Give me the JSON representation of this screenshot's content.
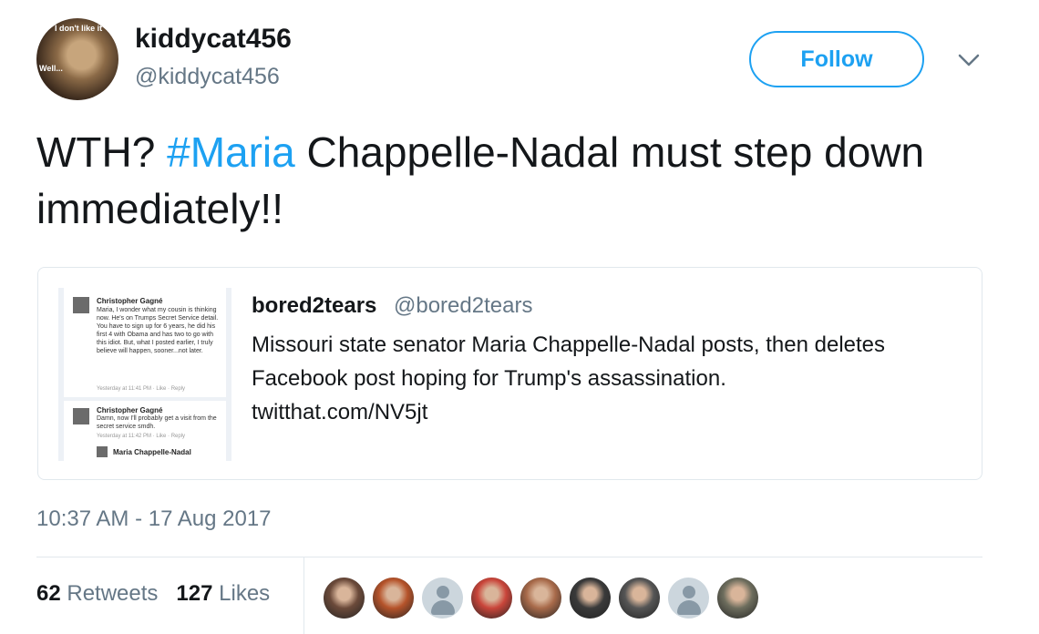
{
  "author": {
    "display_name": "kiddycat456",
    "handle": "@kiddycat456",
    "avatar_text_top": "I don't like it",
    "avatar_text_left": "Well..."
  },
  "follow_label": "Follow",
  "tweet": {
    "text_before": "WTH? ",
    "hashtag": "#Maria",
    "text_after": " Chappelle-Nadal must step down immediately!!"
  },
  "quoted": {
    "name": "bored2tears",
    "handle": "@bored2tears",
    "text": "Missouri state senator Maria Chappelle-Nadal posts, then deletes Facebook post hoping for Trump's assassination.",
    "link": "twitthat.com/NV5jt",
    "thumbnail": {
      "comment1_name": "Christopher Gagné",
      "comment1_text": "Maria, I wonder what my cousin is thinking now. He's on Trumps Secret Service detail. You have to sign up for 6 years, he did his first 4 with Obama and has two to go with this idiot. But, what I posted earlier, I truly believe will happen, sooner...not later.",
      "comment1_meta": "Yesterday at 11:41 PM · Like · Reply",
      "comment2_name": "Christopher Gagné",
      "comment2_text": "Damn, now I'll probably get a visit from the secret service smdh.",
      "comment2_meta": "Yesterday at 11:42 PM · Like · Reply",
      "comment3_name": "Maria Chappelle-Nadal"
    }
  },
  "timestamp": "10:37 AM - 17 Aug 2017",
  "stats": {
    "retweets_count": "62",
    "retweets_label": "Retweets",
    "likes_count": "127",
    "likes_label": "Likes"
  },
  "likers": [
    {
      "color": "#6b4a3a"
    },
    {
      "color": "#b5532a"
    },
    {
      "color": "default"
    },
    {
      "color": "#c9453a"
    },
    {
      "color": "#a86a4a"
    },
    {
      "color": "#3a3a3a"
    },
    {
      "color": "#555555"
    },
    {
      "color": "default"
    },
    {
      "color": "#6d6d5d"
    }
  ],
  "colors": {
    "accent": "#1da1f2",
    "muted": "#657786",
    "text": "#14171a",
    "border": "#e1e8ed"
  }
}
